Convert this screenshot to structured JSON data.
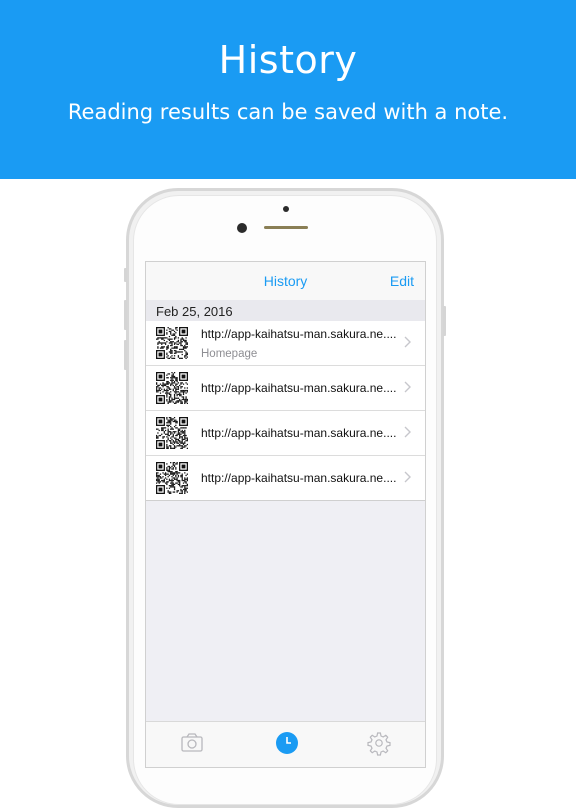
{
  "banner": {
    "title": "History",
    "subtitle": "Reading results can be saved with a note."
  },
  "nav": {
    "title": "History",
    "edit_label": "Edit"
  },
  "section": {
    "date": "Feb 25, 2016"
  },
  "rows": [
    {
      "url": "http://app-kaihatsu-man.sakura.ne....",
      "note": "Homepage"
    },
    {
      "url": "http://app-kaihatsu-man.sakura.ne....",
      "note": ""
    },
    {
      "url": "http://app-kaihatsu-man.sakura.ne....",
      "note": ""
    },
    {
      "url": "http://app-kaihatsu-man.sakura.ne....",
      "note": ""
    }
  ],
  "tabs": [
    {
      "icon": "camera-icon",
      "selected": false
    },
    {
      "icon": "clock-icon",
      "selected": true
    },
    {
      "icon": "gear-icon",
      "selected": false
    }
  ],
  "colors": {
    "accent": "#1a9bf3",
    "tab_inactive": "#b8b8bd"
  }
}
